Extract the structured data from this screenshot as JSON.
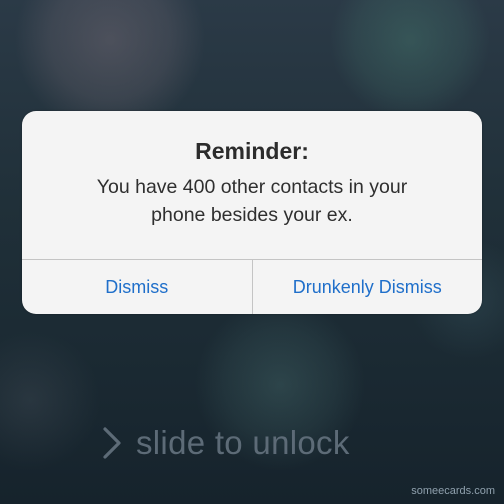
{
  "alert": {
    "title": "Reminder:",
    "message_line1": "You have 400 other contacts in your",
    "message_line2": "phone besides your ex.",
    "buttons": [
      {
        "label": "Dismiss"
      },
      {
        "label": "Drunkenly Dismiss"
      }
    ]
  },
  "lock_slider": {
    "label": "slide to unlock",
    "icon": "chevron-right-icon"
  },
  "watermark": "someecards.com",
  "colors": {
    "button_text": "#1f6fca",
    "alert_background": "#f4f4f4"
  }
}
